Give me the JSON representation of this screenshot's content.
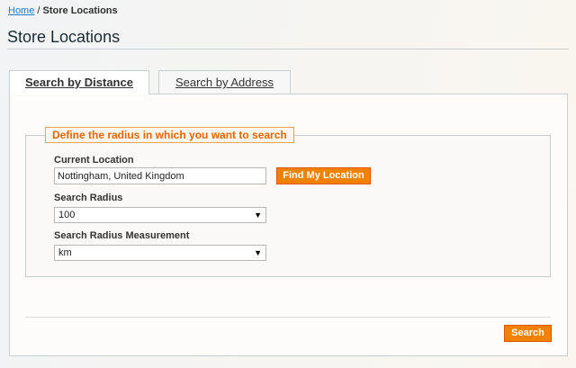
{
  "breadcrumb": {
    "home": "Home",
    "separator": " / ",
    "current": "Store Locations"
  },
  "page": {
    "title": "Store Locations"
  },
  "tabs": [
    {
      "label": "Search by Distance",
      "active": true
    },
    {
      "label": "Search by Address",
      "active": false
    }
  ],
  "form": {
    "legend": "Define the radius in which you want to search",
    "current_location": {
      "label": "Current Location",
      "value": "Nottingham, United Kingdom"
    },
    "find_location_button": "Find My Location",
    "search_radius": {
      "label": "Search Radius",
      "selected": "100"
    },
    "radius_measurement": {
      "label": "Search Radius Measurement",
      "selected": "km"
    },
    "search_button": "Search"
  },
  "colors": {
    "accent": "#f18200",
    "legend_text": "#e26703",
    "link": "#1e7ec8"
  },
  "icons": {
    "select_arrow": "triangle-down-icon"
  }
}
